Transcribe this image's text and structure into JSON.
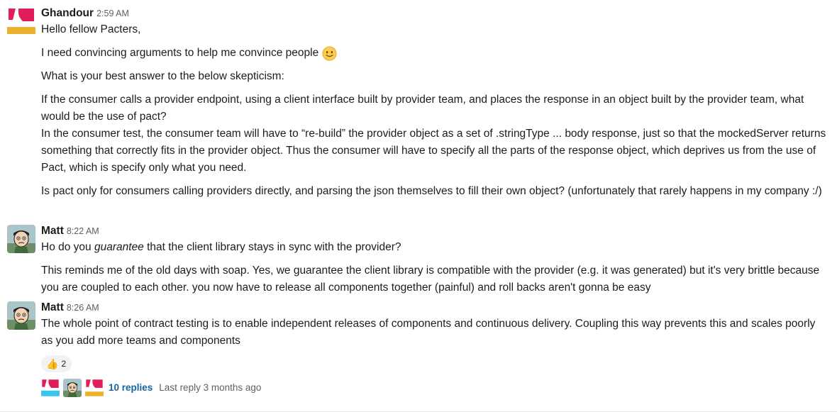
{
  "messages": [
    {
      "author": "Ghandour",
      "time": "2:59 AM",
      "avatar": "ghandour-logo-avatar",
      "paragraphs": [
        "Hello fellow Pacters,",
        "I need convincing arguments to help me convince people",
        "What is your best answer to the below skepticism:",
        "If the consumer calls a provider endpoint, using a client interface built by provider team, and places the response in an object built by the provider team, what would be the use of pact?",
        "In the consumer test, the consumer team will have to “re-build” the provider object as a set of .stringType ... body response, just so that the mockedServer returns something that correctly fits in the provider object. Thus the consumer will have to specify all the parts of the response object, which deprives us from the use of Pact, which is specify only what you need.",
        "Is pact only for consumers calling providers directly, and parsing the json themselves to fill their own object? (unfortunately that rarely happens in my company :/)"
      ],
      "emoji": "slightly-smiling-face"
    },
    {
      "author": "Matt",
      "time": "8:22 AM",
      "avatar": "cartoon-character-avatar",
      "line1_pre": "Ho do you ",
      "line1_em": "guarantee",
      "line1_post": " that the client library stays in sync with the provider?",
      "paragraph2": "This reminds me of the old days with soap. Yes, we guarantee the client library is compatible with the provider (e.g. it was generated) but it's very brittle because you are coupled to each other. you now have to release all components together (painful) and  roll backs aren't gonna be easy"
    },
    {
      "author": "Matt",
      "time": "8:26 AM",
      "avatar": "cartoon-character-avatar",
      "paragraph": "The whole point of contract testing is to enable independent releases of components and continuous delivery. Coupling this way prevents this and scales poorly as you add more teams and components",
      "reaction": {
        "icon": "thumbs-up-icon",
        "emoji": "👍",
        "count": "2"
      },
      "thread": {
        "replies": "10 replies",
        "last_reply": "Last reply 3 months ago"
      }
    }
  ],
  "colors": {
    "link": "#1264a3",
    "logo_red": "#e01e5a",
    "logo_yellow": "#ecb22e",
    "logo_blue": "#36c5f0"
  }
}
